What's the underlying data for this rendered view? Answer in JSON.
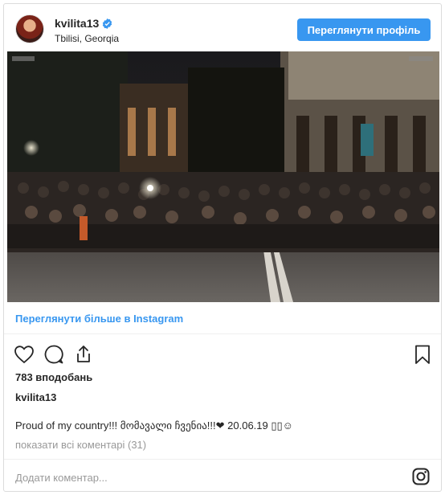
{
  "header": {
    "username": "kvilita13",
    "location": "Tbilisi, Georqia",
    "view_profile_label": "Переглянути профіль"
  },
  "photo": {
    "icons": [
      "photo-of-crowd"
    ]
  },
  "view_more_label": "Переглянути більше в Instagram",
  "actions": {
    "icons": [
      "heart-icon",
      "comment-icon",
      "share-icon",
      "bookmark-icon"
    ]
  },
  "likes_text": "783 вподобань",
  "caption": {
    "username": "kvilita13",
    "text": "Proud of my country!!! მომავალი ჩვენია!!!❤ 20.06.19 ▯▯☺"
  },
  "comments_link": "показати всі коментарі (31)",
  "add_comment_placeholder": "Додати коментар...",
  "colors": {
    "accent": "#3897f0",
    "text": "#262626",
    "muted": "#999999",
    "border": "#dbdbdb"
  }
}
